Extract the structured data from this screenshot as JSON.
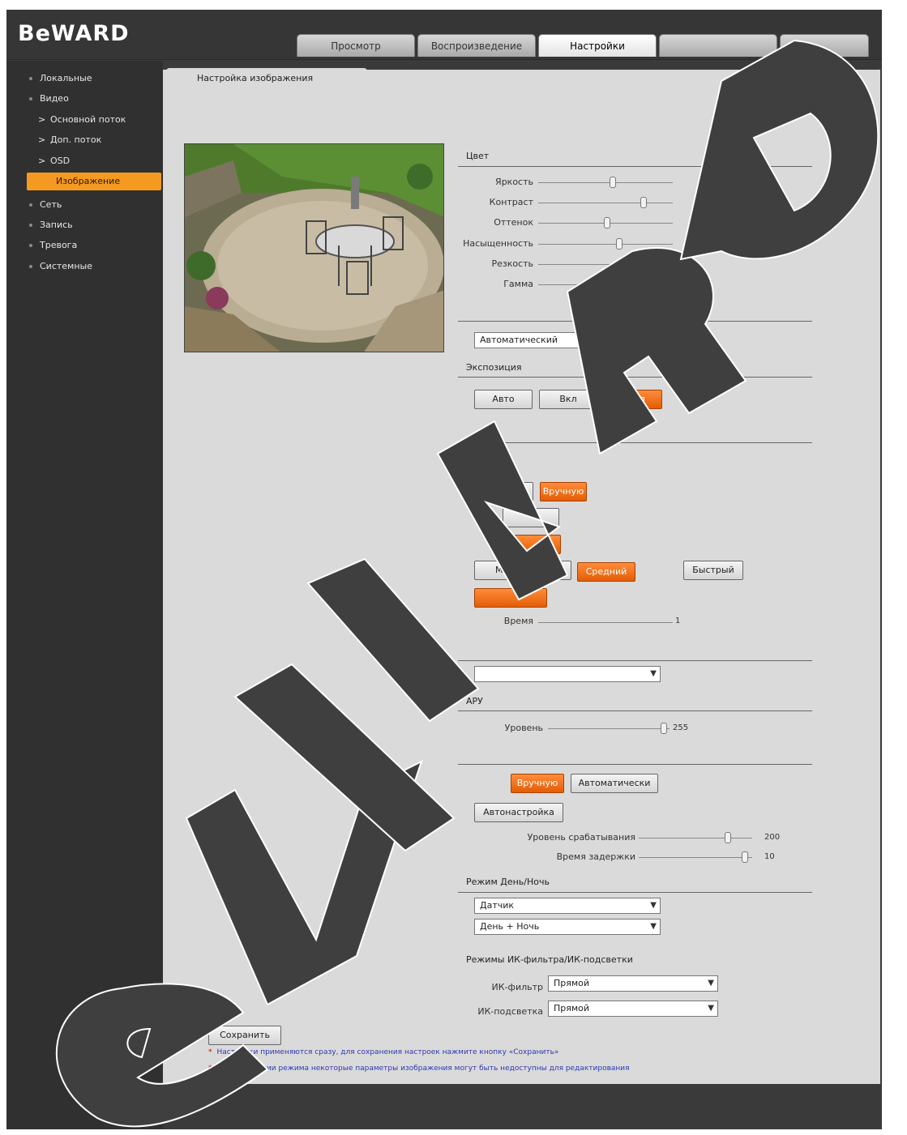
{
  "brand": {
    "logo": "BeWARD"
  },
  "tabs": [
    {
      "label": "Просмотр"
    },
    {
      "label": "Воспроизведение"
    },
    {
      "label": "Настройки",
      "active": true
    }
  ],
  "sidebar": {
    "items": [
      {
        "label": "Локальные"
      },
      {
        "label": "Видео"
      },
      {
        "label": "Основной поток",
        "sub": true
      },
      {
        "label": "Доп. поток",
        "sub": true
      },
      {
        "label": "OSD",
        "sub": true
      },
      {
        "label": "Изображение",
        "sub": true,
        "active": true
      },
      {
        "label": "Сеть"
      },
      {
        "label": "Запись"
      },
      {
        "label": "Тревога"
      },
      {
        "label": "Системные"
      }
    ]
  },
  "page": {
    "subtab_label": "Настройка изображения"
  },
  "color_section": {
    "title": "Цвет",
    "sliders": [
      {
        "label": "Яркость",
        "value": ""
      },
      {
        "label": "Контраст",
        "value": ""
      },
      {
        "label": "Оттенок",
        "value": ""
      },
      {
        "label": "Насыщенность",
        "value": ""
      },
      {
        "label": "Резкость",
        "value": ""
      },
      {
        "label": "Гамма",
        "value": ""
      }
    ]
  },
  "mode_select": {
    "value": "Автоматический"
  },
  "section2": {
    "title": "Экспозиция"
  },
  "exposure_buttons": [
    {
      "label": "Авто",
      "selected": false
    },
    {
      "label": "Вкл",
      "selected": false
    },
    {
      "label": "Выкл",
      "selected": true
    }
  ],
  "wb_buttons": [
    {
      "label": "Авто",
      "selected": false
    },
    {
      "label": "Вручную",
      "selected": true
    }
  ],
  "speed_buttons": [
    {
      "label": "Медленный",
      "selected": false
    },
    {
      "label": "Средний",
      "selected": true
    },
    {
      "label": "Быстрый",
      "selected": false
    }
  ],
  "speed_slider": {
    "label": "Время",
    "value": "1"
  },
  "select2": {
    "value": ""
  },
  "section_level": {
    "title": "АРУ"
  },
  "level_slider": {
    "label": "Уровень",
    "value": "255"
  },
  "auto_buttons": [
    {
      "label": "Вручную",
      "selected": true
    },
    {
      "label": "Автоматически",
      "selected": false
    }
  ],
  "autoadjust_button": {
    "label": "Автонастройка"
  },
  "threshold_sliders": [
    {
      "label": "Уровень срабатывания",
      "value": "200"
    },
    {
      "label": "Время задержки",
      "value": "10"
    }
  ],
  "daynight_section": {
    "title": "Режим День/Ночь"
  },
  "daynight_selects": [
    {
      "value": "Датчик"
    },
    {
      "value": "День + Ночь"
    }
  ],
  "ir_section": {
    "title": "Режимы ИК-фильтра/ИК-подсветки"
  },
  "ir_rows": [
    {
      "label": "ИК-фильтр",
      "value": "Прямой"
    },
    {
      "label": "ИК-подсветка",
      "value": "Прямой"
    }
  ],
  "save_button": {
    "label": "Сохранить"
  },
  "notes": [
    "Настройки применяются сразу, для сохранения настроек нажмите кнопку «Сохранить»",
    "При изменении режима некоторые параметры изображения могут быть недоступны для редактирования"
  ],
  "colors": {
    "accent": "#f59a21",
    "button_orange": "#f0700e",
    "bg_dark": "#3a3a3a",
    "panel": "#dadada"
  }
}
